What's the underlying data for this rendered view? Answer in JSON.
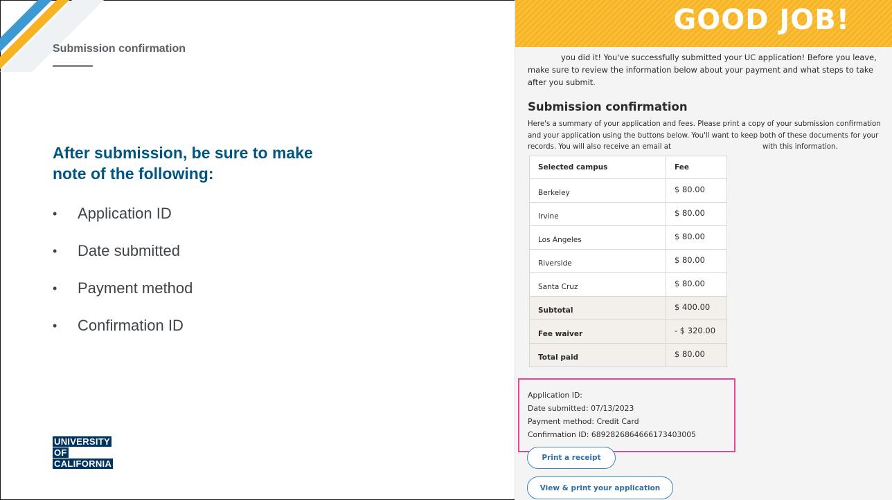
{
  "slide": {
    "section_title": "Submission confirmation",
    "heading": "After submission, be sure to make note of the following:",
    "bullet_items": [
      "Application ID",
      "Date submitted",
      "Payment method",
      "Confirmation ID"
    ],
    "bullet_glyph": "•",
    "logo_lines": [
      "UNIVERSITY",
      "OF",
      "CALIFORNIA"
    ],
    "colors": {
      "heading": "#005581",
      "logo_bg": "#003262",
      "stripe_yellow": "#f7b324",
      "stripe_blue": "#3d9ad1"
    }
  },
  "screenshot": {
    "banner_text": "GOOD JOB!",
    "intro": "you did it! You've successfully submitted your UC application! Before you leave, make sure to review the information below about your payment and what steps to take after you submit.",
    "subheading": "Submission confirmation",
    "summary_before": "Here's a summary of your application and fees. Please print a copy of your submission confirmation and your application using the buttons below. You'll want to keep both of these documents for your records. You will also receive an email at",
    "summary_after": "with this information.",
    "table": {
      "headers": [
        "Selected campus",
        "Fee"
      ],
      "rows": [
        {
          "campus": "Berkeley",
          "fee": "$ 80.00"
        },
        {
          "campus": "Irvine",
          "fee": "$ 80.00"
        },
        {
          "campus": "Los Angeles",
          "fee": "$ 80.00"
        },
        {
          "campus": "Riverside",
          "fee": "$ 80.00"
        },
        {
          "campus": "Santa Cruz",
          "fee": "$ 80.00"
        }
      ],
      "summary_rows": [
        {
          "label": "Subtotal",
          "fee": "$ 400.00"
        },
        {
          "label": "Fee waiver",
          "fee": "- $ 320.00"
        },
        {
          "label": "Total paid",
          "fee": "$ 80.00"
        }
      ]
    },
    "id_info": {
      "application_id": "Application ID:",
      "date_submitted": "Date submitted: 07/13/2023",
      "payment_method": "Payment method: Credit Card",
      "confirmation_id": "Confirmation ID: 6892826864666173403005"
    },
    "buttons": {
      "print_receipt": "Print a receipt",
      "view_print_application": "View & print your application"
    },
    "colors": {
      "banner": "#f7b324",
      "highlight_box": "#e2479a",
      "button_text": "#2e6ea3"
    }
  }
}
